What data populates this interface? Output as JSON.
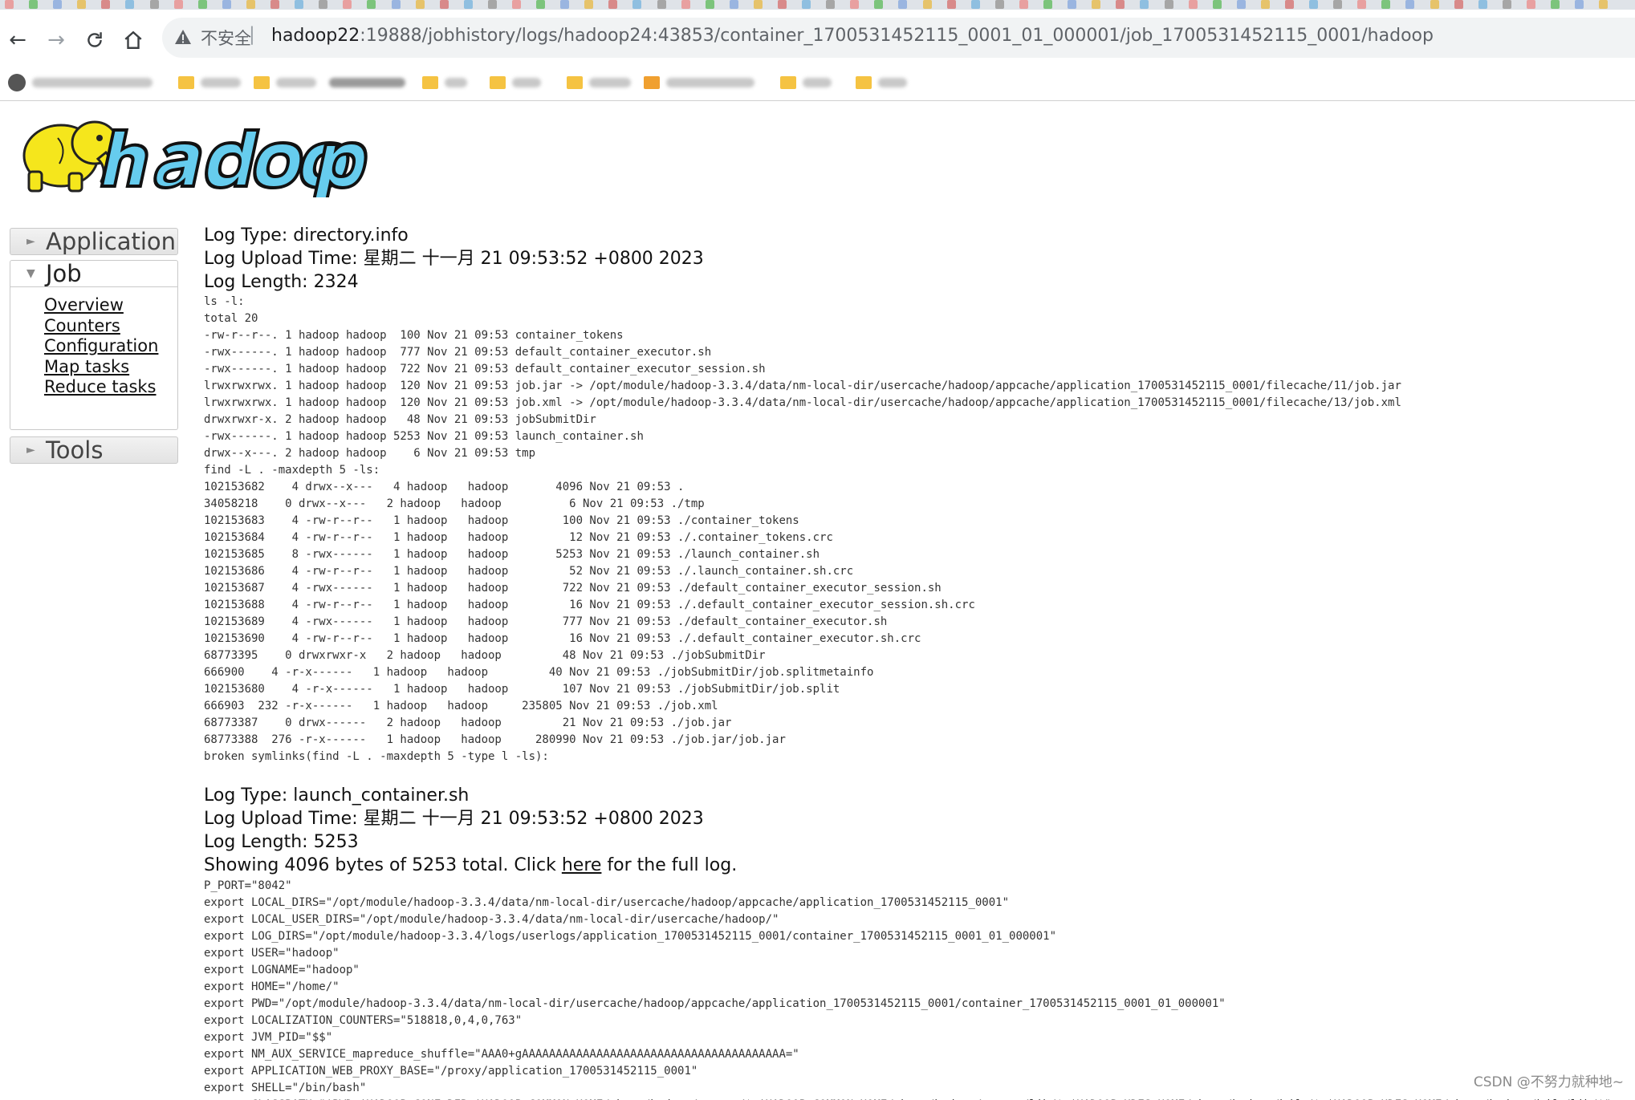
{
  "browser": {
    "back_icon": "arrow-left-icon",
    "forward_icon": "arrow-right-icon",
    "reload_icon": "reload-icon",
    "home_icon": "home-icon",
    "security_label": "不安全",
    "url_host": "hadoop22",
    "url_rest": ":19888/jobhistory/logs/hadoop24:43853/container_1700531452115_0001_01_000001/job_1700531452115_0001/hadoop"
  },
  "sidebar": {
    "application_label": "Application",
    "job_label": "Job",
    "job_links": [
      "Overview",
      "Counters",
      "Configuration",
      "Map tasks",
      "Reduce tasks"
    ],
    "tools_label": "Tools"
  },
  "logs": [
    {
      "type_line": "Log Type: directory.info",
      "upload_line": "Log Upload Time: 星期二 十一月 21 09:53:52 +0800 2023",
      "length_line": "Log Length: 2324",
      "lines": [
        "ls -l:",
        "total 20",
        "-rw-r--r--. 1 hadoop hadoop  100 Nov 21 09:53 container_tokens",
        "-rwx------. 1 hadoop hadoop  777 Nov 21 09:53 default_container_executor.sh",
        "-rwx------. 1 hadoop hadoop  722 Nov 21 09:53 default_container_executor_session.sh",
        "lrwxrwxrwx. 1 hadoop hadoop  120 Nov 21 09:53 job.jar -> /opt/module/hadoop-3.3.4/data/nm-local-dir/usercache/hadoop/appcache/application_1700531452115_0001/filecache/11/job.jar",
        "lrwxrwxrwx. 1 hadoop hadoop  120 Nov 21 09:53 job.xml -> /opt/module/hadoop-3.3.4/data/nm-local-dir/usercache/hadoop/appcache/application_1700531452115_0001/filecache/13/job.xml",
        "drwxrwxr-x. 2 hadoop hadoop   48 Nov 21 09:53 jobSubmitDir",
        "-rwx------. 1 hadoop hadoop 5253 Nov 21 09:53 launch_container.sh",
        "drwx--x---. 2 hadoop hadoop    6 Nov 21 09:53 tmp",
        "find -L . -maxdepth 5 -ls:",
        "102153682    4 drwx--x---   4 hadoop   hadoop       4096 Nov 21 09:53 .",
        "34058218    0 drwx--x---   2 hadoop   hadoop          6 Nov 21 09:53 ./tmp",
        "102153683    4 -rw-r--r--   1 hadoop   hadoop        100 Nov 21 09:53 ./container_tokens",
        "102153684    4 -rw-r--r--   1 hadoop   hadoop         12 Nov 21 09:53 ./.container_tokens.crc",
        "102153685    8 -rwx------   1 hadoop   hadoop       5253 Nov 21 09:53 ./launch_container.sh",
        "102153686    4 -rw-r--r--   1 hadoop   hadoop         52 Nov 21 09:53 ./.launch_container.sh.crc",
        "102153687    4 -rwx------   1 hadoop   hadoop        722 Nov 21 09:53 ./default_container_executor_session.sh",
        "102153688    4 -rw-r--r--   1 hadoop   hadoop         16 Nov 21 09:53 ./.default_container_executor_session.sh.crc",
        "102153689    4 -rwx------   1 hadoop   hadoop        777 Nov 21 09:53 ./default_container_executor.sh",
        "102153690    4 -rw-r--r--   1 hadoop   hadoop         16 Nov 21 09:53 ./.default_container_executor.sh.crc",
        "68773395    0 drwxrwxr-x   2 hadoop   hadoop         48 Nov 21 09:53 ./jobSubmitDir",
        "666900    4 -r-x------   1 hadoop   hadoop         40 Nov 21 09:53 ./jobSubmitDir/job.splitmetainfo",
        "102153680    4 -r-x------   1 hadoop   hadoop        107 Nov 21 09:53 ./jobSubmitDir/job.split",
        "666903  232 -r-x------   1 hadoop   hadoop     235805 Nov 21 09:53 ./job.xml",
        "68773387    0 drwx------   2 hadoop   hadoop         21 Nov 21 09:53 ./job.jar",
        "68773388  276 -r-x------   1 hadoop   hadoop     280990 Nov 21 09:53 ./job.jar/job.jar",
        "broken symlinks(find -L . -maxdepth 5 -type l -ls):"
      ]
    },
    {
      "type_line": "Log Type: launch_container.sh",
      "upload_line": "Log Upload Time: 星期二 十一月 21 09:53:52 +0800 2023",
      "length_line": "Log Length: 5253",
      "showing_prefix": "Showing 4096 bytes of 5253 total. Click ",
      "showing_link": "here",
      "showing_suffix": " for the full log.",
      "lines": [
        "P_PORT=\"8042\"",
        "export LOCAL_DIRS=\"/opt/module/hadoop-3.3.4/data/nm-local-dir/usercache/hadoop/appcache/application_1700531452115_0001\"",
        "export LOCAL_USER_DIRS=\"/opt/module/hadoop-3.3.4/data/nm-local-dir/usercache/hadoop/\"",
        "export LOG_DIRS=\"/opt/module/hadoop-3.3.4/logs/userlogs/application_1700531452115_0001/container_1700531452115_0001_01_000001\"",
        "export USER=\"hadoop\"",
        "export LOGNAME=\"hadoop\"",
        "export HOME=\"/home/\"",
        "export PWD=\"/opt/module/hadoop-3.3.4/data/nm-local-dir/usercache/hadoop/appcache/application_1700531452115_0001/container_1700531452115_0001_01_000001\"",
        "export LOCALIZATION_COUNTERS=\"518818,0,4,0,763\"",
        "export JVM_PID=\"$$\"",
        "export NM_AUX_SERVICE_mapreduce_shuffle=\"AAA0+gAAAAAAAAAAAAAAAAAAAAAAAAAAAAAAAAAAAAAAA=\"",
        "export APPLICATION_WEB_PROXY_BASE=\"/proxy/application_1700531452115_0001\"",
        "export SHELL=\"/bin/bash\"",
        "export CLASSPATH=\"$PWD:$HADOOP_CONF_DIR:$HADOOP_COMMON_HOME/share/hadoop/common/*:$HADOOP_COMMON_HOME/share/hadoop/common/lib/*:$HADOOP_HDFS_HOME/share/hadoop/hdfs/*:$HADOOP_HDFS_HOME/share/hadoop/hdfs/lib/*\""
      ]
    }
  ],
  "watermark": "CSDN @不努力就种地~",
  "colors": {
    "logo_yellow": "#f5e61c",
    "logo_blue": "#66ccee",
    "link": "#111111"
  }
}
